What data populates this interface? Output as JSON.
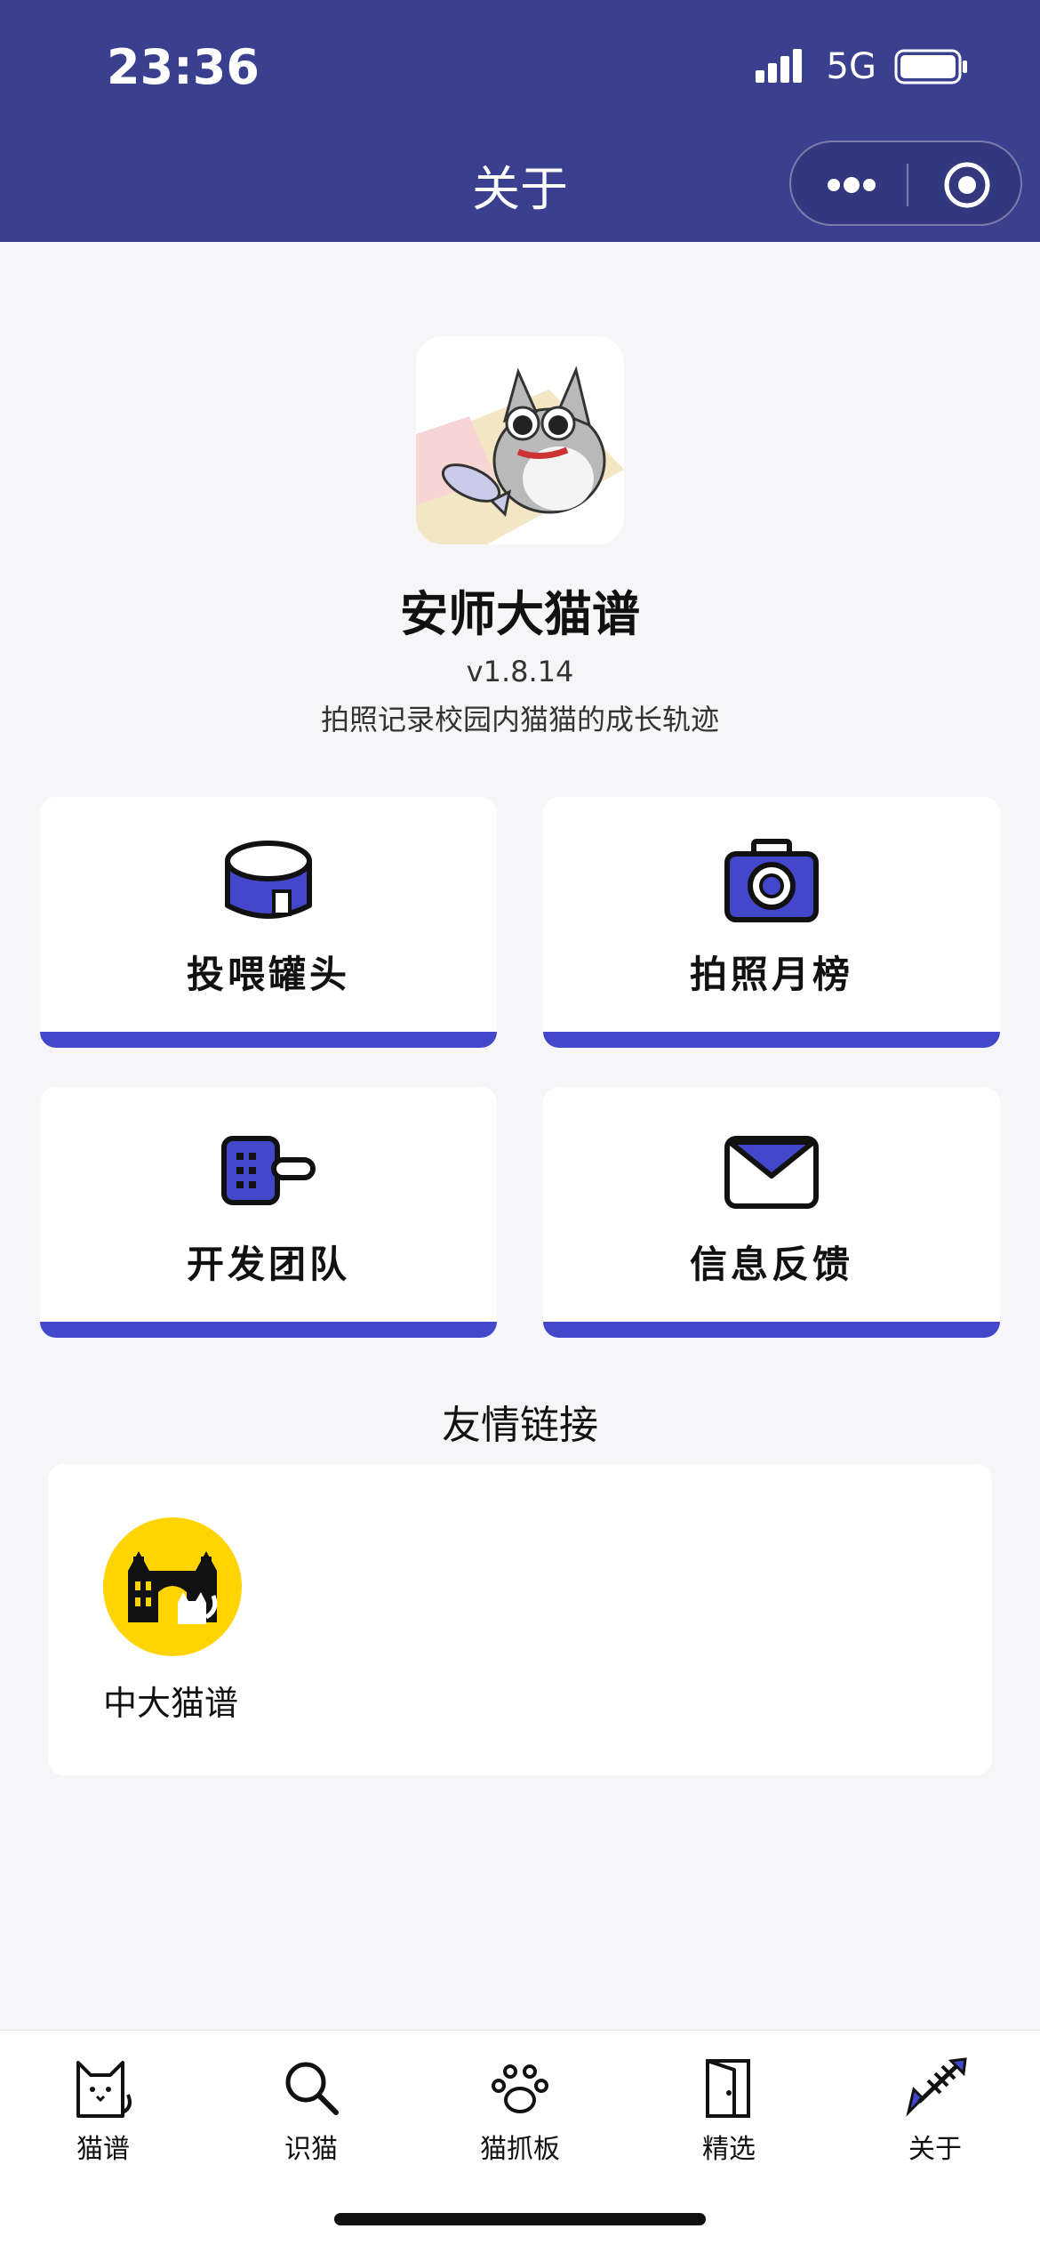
{
  "status": {
    "time": "23:36",
    "network": "5G"
  },
  "nav": {
    "title": "关于"
  },
  "app": {
    "name": "安师大猫谱",
    "version": "v1.8.14",
    "description": "拍照记录校园内猫猫的成长轨迹"
  },
  "cards": [
    {
      "label": "投喂罐头",
      "icon": "can-icon"
    },
    {
      "label": "拍照月榜",
      "icon": "camera-icon"
    },
    {
      "label": "开发团队",
      "icon": "spatula-icon"
    },
    {
      "label": "信息反馈",
      "icon": "envelope-icon"
    }
  ],
  "friend_links": {
    "title": "友情链接",
    "items": [
      {
        "name": "中大猫谱",
        "icon": "building-cat-logo"
      }
    ]
  },
  "tabbar": {
    "items": [
      {
        "label": "猫谱",
        "icon": "cat-icon"
      },
      {
        "label": "识猫",
        "icon": "search-icon"
      },
      {
        "label": "猫抓板",
        "icon": "paw-icon"
      },
      {
        "label": "精选",
        "icon": "door-icon"
      },
      {
        "label": "关于",
        "icon": "fishbone-icon",
        "active": true
      }
    ]
  },
  "colors": {
    "header": "#3b3f8f",
    "accent": "#4347c9",
    "logo_bg": "#ffd400",
    "page_bg": "#f6f6f8"
  }
}
